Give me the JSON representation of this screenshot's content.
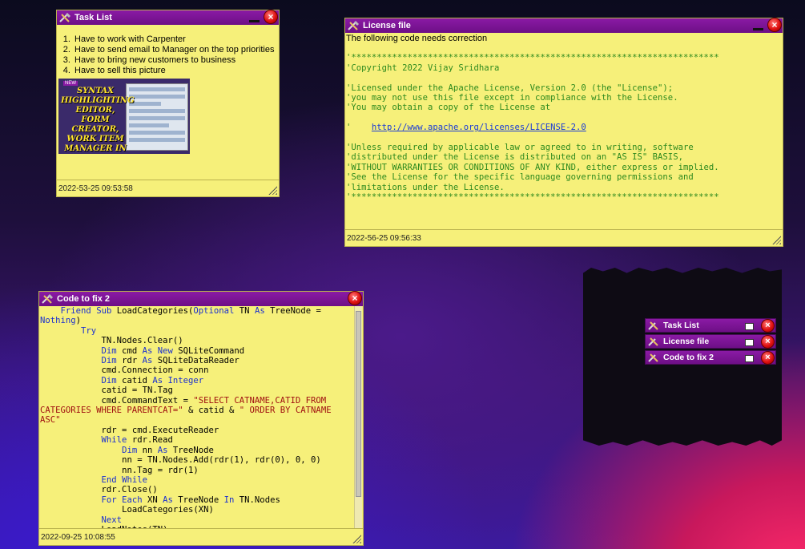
{
  "task_window": {
    "title": "Task List",
    "items": [
      "Have to work with Carpenter",
      "Have to send email to Manager on the top priorities",
      "Have to bring new customers to business",
      "Have to sell this picture"
    ],
    "image_caption": "SYNTAX HIGHLIGHTING EDITOR, FORM CREATOR, WORK ITEM MANAGER IN ONE?",
    "image_badge": "NEW",
    "footer": "2022-53-25 09:53:58",
    "close_label": "×"
  },
  "license_window": {
    "title": "License file",
    "heading": "The following code needs correction",
    "lines": [
      "'************************************************************************",
      "'Copyright 2022 Vijay Sridhara",
      "",
      "'Licensed under the Apache License, Version 2.0 (the \"License\");",
      "'you may not use this file except in compliance with the License.",
      "'You may obtain a copy of the License at",
      "",
      "'    ",
      "",
      "'Unless required by applicable law or agreed to in writing, software",
      "'distributed under the License is distributed on an \"AS IS\" BASIS,",
      "'WITHOUT WARRANTIES OR CONDITIONS OF ANY KIND, either express or implied.",
      "'See the License for the specific language governing permissions and",
      "'limitations under the License.",
      "'************************************************************************"
    ],
    "link": "http://www.apache.org/licenses/LICENSE-2.0",
    "footer": "2022-56-25 09:56:33",
    "close_label": "×"
  },
  "code_window": {
    "title": "Code to fix 2",
    "footer": "2022-09-25 10:08:55",
    "close_label": "×",
    "code_lines": [
      [
        [
          "    ",
          ""
        ],
        [
          "Friend",
          "kw"
        ],
        [
          " ",
          ""
        ],
        [
          "Sub",
          "kw"
        ],
        [
          " LoadCategories(",
          ""
        ],
        [
          "Optional",
          "kw"
        ],
        [
          " TN ",
          ""
        ],
        [
          "As",
          "kw"
        ],
        [
          " TreeNode = ",
          ""
        ]
      ],
      [
        [
          "Nothing",
          "kw"
        ],
        [
          ")",
          ""
        ]
      ],
      [
        [
          "        ",
          ""
        ],
        [
          "Try",
          "kw"
        ]
      ],
      [
        [
          "            TN.Nodes.Clear()",
          ""
        ]
      ],
      [
        [
          "            ",
          ""
        ],
        [
          "Dim",
          "kw"
        ],
        [
          " cmd ",
          ""
        ],
        [
          "As",
          "kw"
        ],
        [
          " ",
          ""
        ],
        [
          "New",
          "kw"
        ],
        [
          " SQLiteCommand",
          ""
        ]
      ],
      [
        [
          "            ",
          ""
        ],
        [
          "Dim",
          "kw"
        ],
        [
          " rdr ",
          ""
        ],
        [
          "As",
          "kw"
        ],
        [
          " SQLiteDataReader",
          ""
        ]
      ],
      [
        [
          "            cmd.Connection = conn",
          ""
        ]
      ],
      [
        [
          "            ",
          ""
        ],
        [
          "Dim",
          "kw"
        ],
        [
          " catid ",
          ""
        ],
        [
          "As",
          "kw"
        ],
        [
          " ",
          ""
        ],
        [
          "Integer",
          "kw"
        ]
      ],
      [
        [
          "            catid = TN.Tag",
          ""
        ]
      ],
      [
        [
          "            cmd.CommandText = ",
          ""
        ],
        [
          "\"SELECT CATNAME,CATID FROM ",
          "str"
        ]
      ],
      [
        [
          "CATEGORIES WHERE PARENTCAT=\"",
          "str"
        ],
        [
          " & catid & ",
          ""
        ],
        [
          "\" ORDER BY CATNAME ",
          "str"
        ]
      ],
      [
        [
          "ASC\"",
          "str"
        ]
      ],
      [
        [
          "            rdr = cmd.ExecuteReader",
          ""
        ]
      ],
      [
        [
          "            ",
          ""
        ],
        [
          "While",
          "kw"
        ],
        [
          " rdr.Read",
          ""
        ]
      ],
      [
        [
          "                ",
          ""
        ],
        [
          "Dim",
          "kw"
        ],
        [
          " nn ",
          ""
        ],
        [
          "As",
          "kw"
        ],
        [
          " TreeNode",
          ""
        ]
      ],
      [
        [
          "                nn = TN.Nodes.Add(rdr(1), rdr(0), 0, 0)",
          ""
        ]
      ],
      [
        [
          "                nn.Tag = rdr(1)",
          ""
        ]
      ],
      [
        [
          "            ",
          ""
        ],
        [
          "End",
          "kw"
        ],
        [
          " ",
          ""
        ],
        [
          "While",
          "kw"
        ]
      ],
      [
        [
          "            rdr.Close()",
          ""
        ]
      ],
      [
        [
          "            ",
          ""
        ],
        [
          "For",
          "kw"
        ],
        [
          " ",
          ""
        ],
        [
          "Each",
          "kw"
        ],
        [
          " XN ",
          ""
        ],
        [
          "As",
          "kw"
        ],
        [
          " TreeNode ",
          ""
        ],
        [
          "In",
          "kw"
        ],
        [
          " TN.Nodes",
          ""
        ]
      ],
      [
        [
          "                LoadCategories(XN)",
          ""
        ]
      ],
      [
        [
          "            ",
          ""
        ],
        [
          "Next",
          "kw"
        ]
      ],
      [
        [
          "            LoadNotes(TN)",
          ""
        ]
      ]
    ]
  },
  "dock": {
    "items": [
      "Task List",
      "License file",
      "Code to fix 2"
    ],
    "close_label": "×"
  },
  "colors": {
    "note_bg": "#f6f07a",
    "titlebar": "#7a129a",
    "comment_green": "#2e8a1e",
    "keyword_blue": "#1a2fd0",
    "string_red": "#a01010"
  }
}
